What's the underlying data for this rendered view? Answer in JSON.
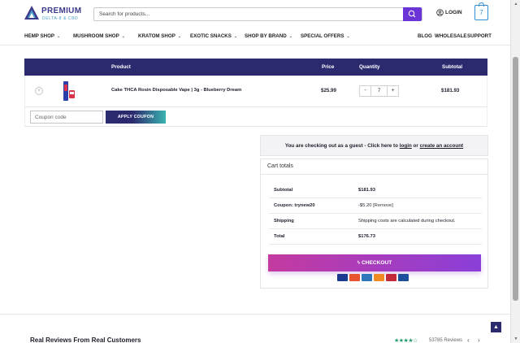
{
  "brand": {
    "title": "PREMIUM",
    "subtitle": "DELTA-8 & CBD"
  },
  "search": {
    "placeholder": "Search for products..."
  },
  "account": {
    "login_label": "LOGIN"
  },
  "cart": {
    "count": "7"
  },
  "nav": {
    "left": [
      "HEMP SHOP",
      "MUSHROOM SHOP",
      "KRATOM SHOP",
      "EXOTIC SNACKS",
      "SHOP BY BRAND",
      "SPECIAL OFFERS"
    ],
    "right": [
      "BLOG",
      "WHOLESALE",
      "SUPPORT"
    ]
  },
  "table": {
    "headers": {
      "product": "Product",
      "price": "Price",
      "quantity": "Quantity",
      "subtotal": "Subtotal"
    },
    "rows": [
      {
        "name": "Cake THCA Rosin Disposable Vape | 3g - Blueberry Dream",
        "price": "$25.99",
        "qty": "7",
        "subtotal": "$181.93"
      }
    ]
  },
  "coupon": {
    "placeholder": "Coupon code",
    "apply_label": "APPLY COUPON"
  },
  "guest": {
    "prefix": "You are checking out as a guest - Click here to ",
    "login_link": "login",
    "middle": " or ",
    "create_link": "create an account"
  },
  "totals": {
    "title": "Cart totals",
    "rows": [
      {
        "label": "Subtotal",
        "value": "$181.93"
      },
      {
        "label": "Coupon: trynew20",
        "value": "-$5.20",
        "extra": "[Remove]"
      },
      {
        "label": "Shipping",
        "value": "Shipping costs are calculated during checkout."
      },
      {
        "label": "Total",
        "value": "$176.73"
      }
    ],
    "checkout_label": "CHECKOUT"
  },
  "payment_icons": [
    "visa-icon",
    "mastercard-icon",
    "amex-icon",
    "discover-icon",
    "jcb-icon",
    "diners-icon"
  ],
  "reviews": {
    "title": "Real Reviews From Real Customers",
    "count": "53785 Reviews",
    "stars": "★★★★☆"
  },
  "colors": {
    "primary": "#2c2a6e",
    "accent": "#6b34d6",
    "checkout_start": "#c43aa0",
    "checkout_end": "#8a3fd9",
    "teal": "#3bb3b0"
  }
}
